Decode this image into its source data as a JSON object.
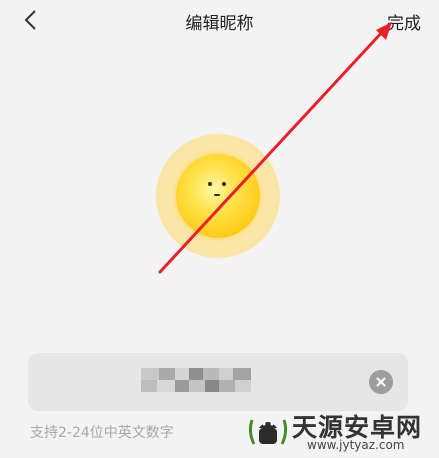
{
  "header": {
    "title": "编辑昵称",
    "done_label": "完成",
    "back_icon": "chevron-left-icon"
  },
  "avatar": {
    "icon": "sun-face-avatar",
    "halo_color": "#fbe7a8",
    "face_color": "#ffd52b"
  },
  "nickname_input": {
    "value_obscured": true,
    "clear_icon": "clear-circle-icon"
  },
  "hint": {
    "text": "支持2-24位中英文数字"
  },
  "watermark": {
    "text": "天源安卓网",
    "url": "www.jytyaz.com",
    "logo": "android-logo"
  },
  "annotation": {
    "type": "red-arrow",
    "color": "#e8202a",
    "target": "done-button"
  }
}
